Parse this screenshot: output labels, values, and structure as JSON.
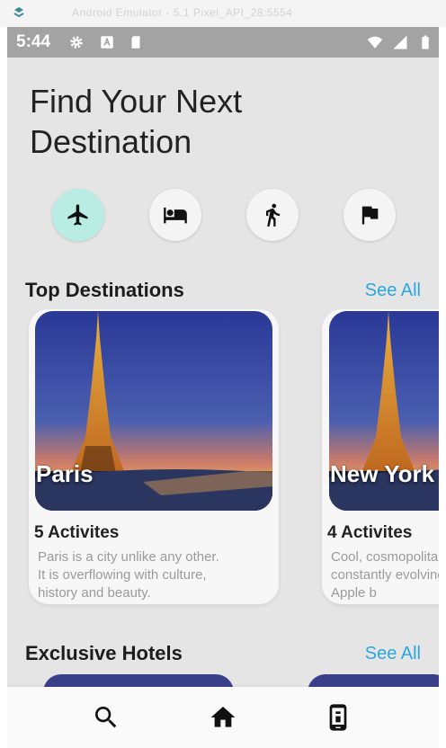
{
  "emulator": {
    "title": "Android Emulator - 5.1 Pixel_API_28:5554"
  },
  "status_bar": {
    "time": "5:44"
  },
  "header": {
    "title": "Find Your Next Destination"
  },
  "categories": [
    {
      "icon": "airplane-icon",
      "active": true
    },
    {
      "icon": "hotel-bed-icon",
      "active": false
    },
    {
      "icon": "hiking-icon",
      "active": false
    },
    {
      "icon": "flag-icon",
      "active": false
    }
  ],
  "top_destinations": {
    "title": "Top Destinations",
    "see_all": "See All",
    "cards": [
      {
        "city": "Paris",
        "activities": "5 Activites",
        "description": "Paris is a city unlike any other. It is overflowing with culture, history and beauty."
      },
      {
        "city": "New York",
        "activities": "4 Activites",
        "description": "Cool, cosmopolitan, crowded, constantly evolving... the Big Apple b"
      }
    ]
  },
  "exclusive_hotels": {
    "title": "Exclusive Hotels",
    "see_all": "See All"
  },
  "bottom_nav": [
    {
      "icon": "search-icon"
    },
    {
      "icon": "home-icon"
    },
    {
      "icon": "phone-icon"
    }
  ],
  "colors": {
    "accent": "#2aa6df",
    "active_category": "#b9ede4",
    "background": "#e5e5e5"
  }
}
